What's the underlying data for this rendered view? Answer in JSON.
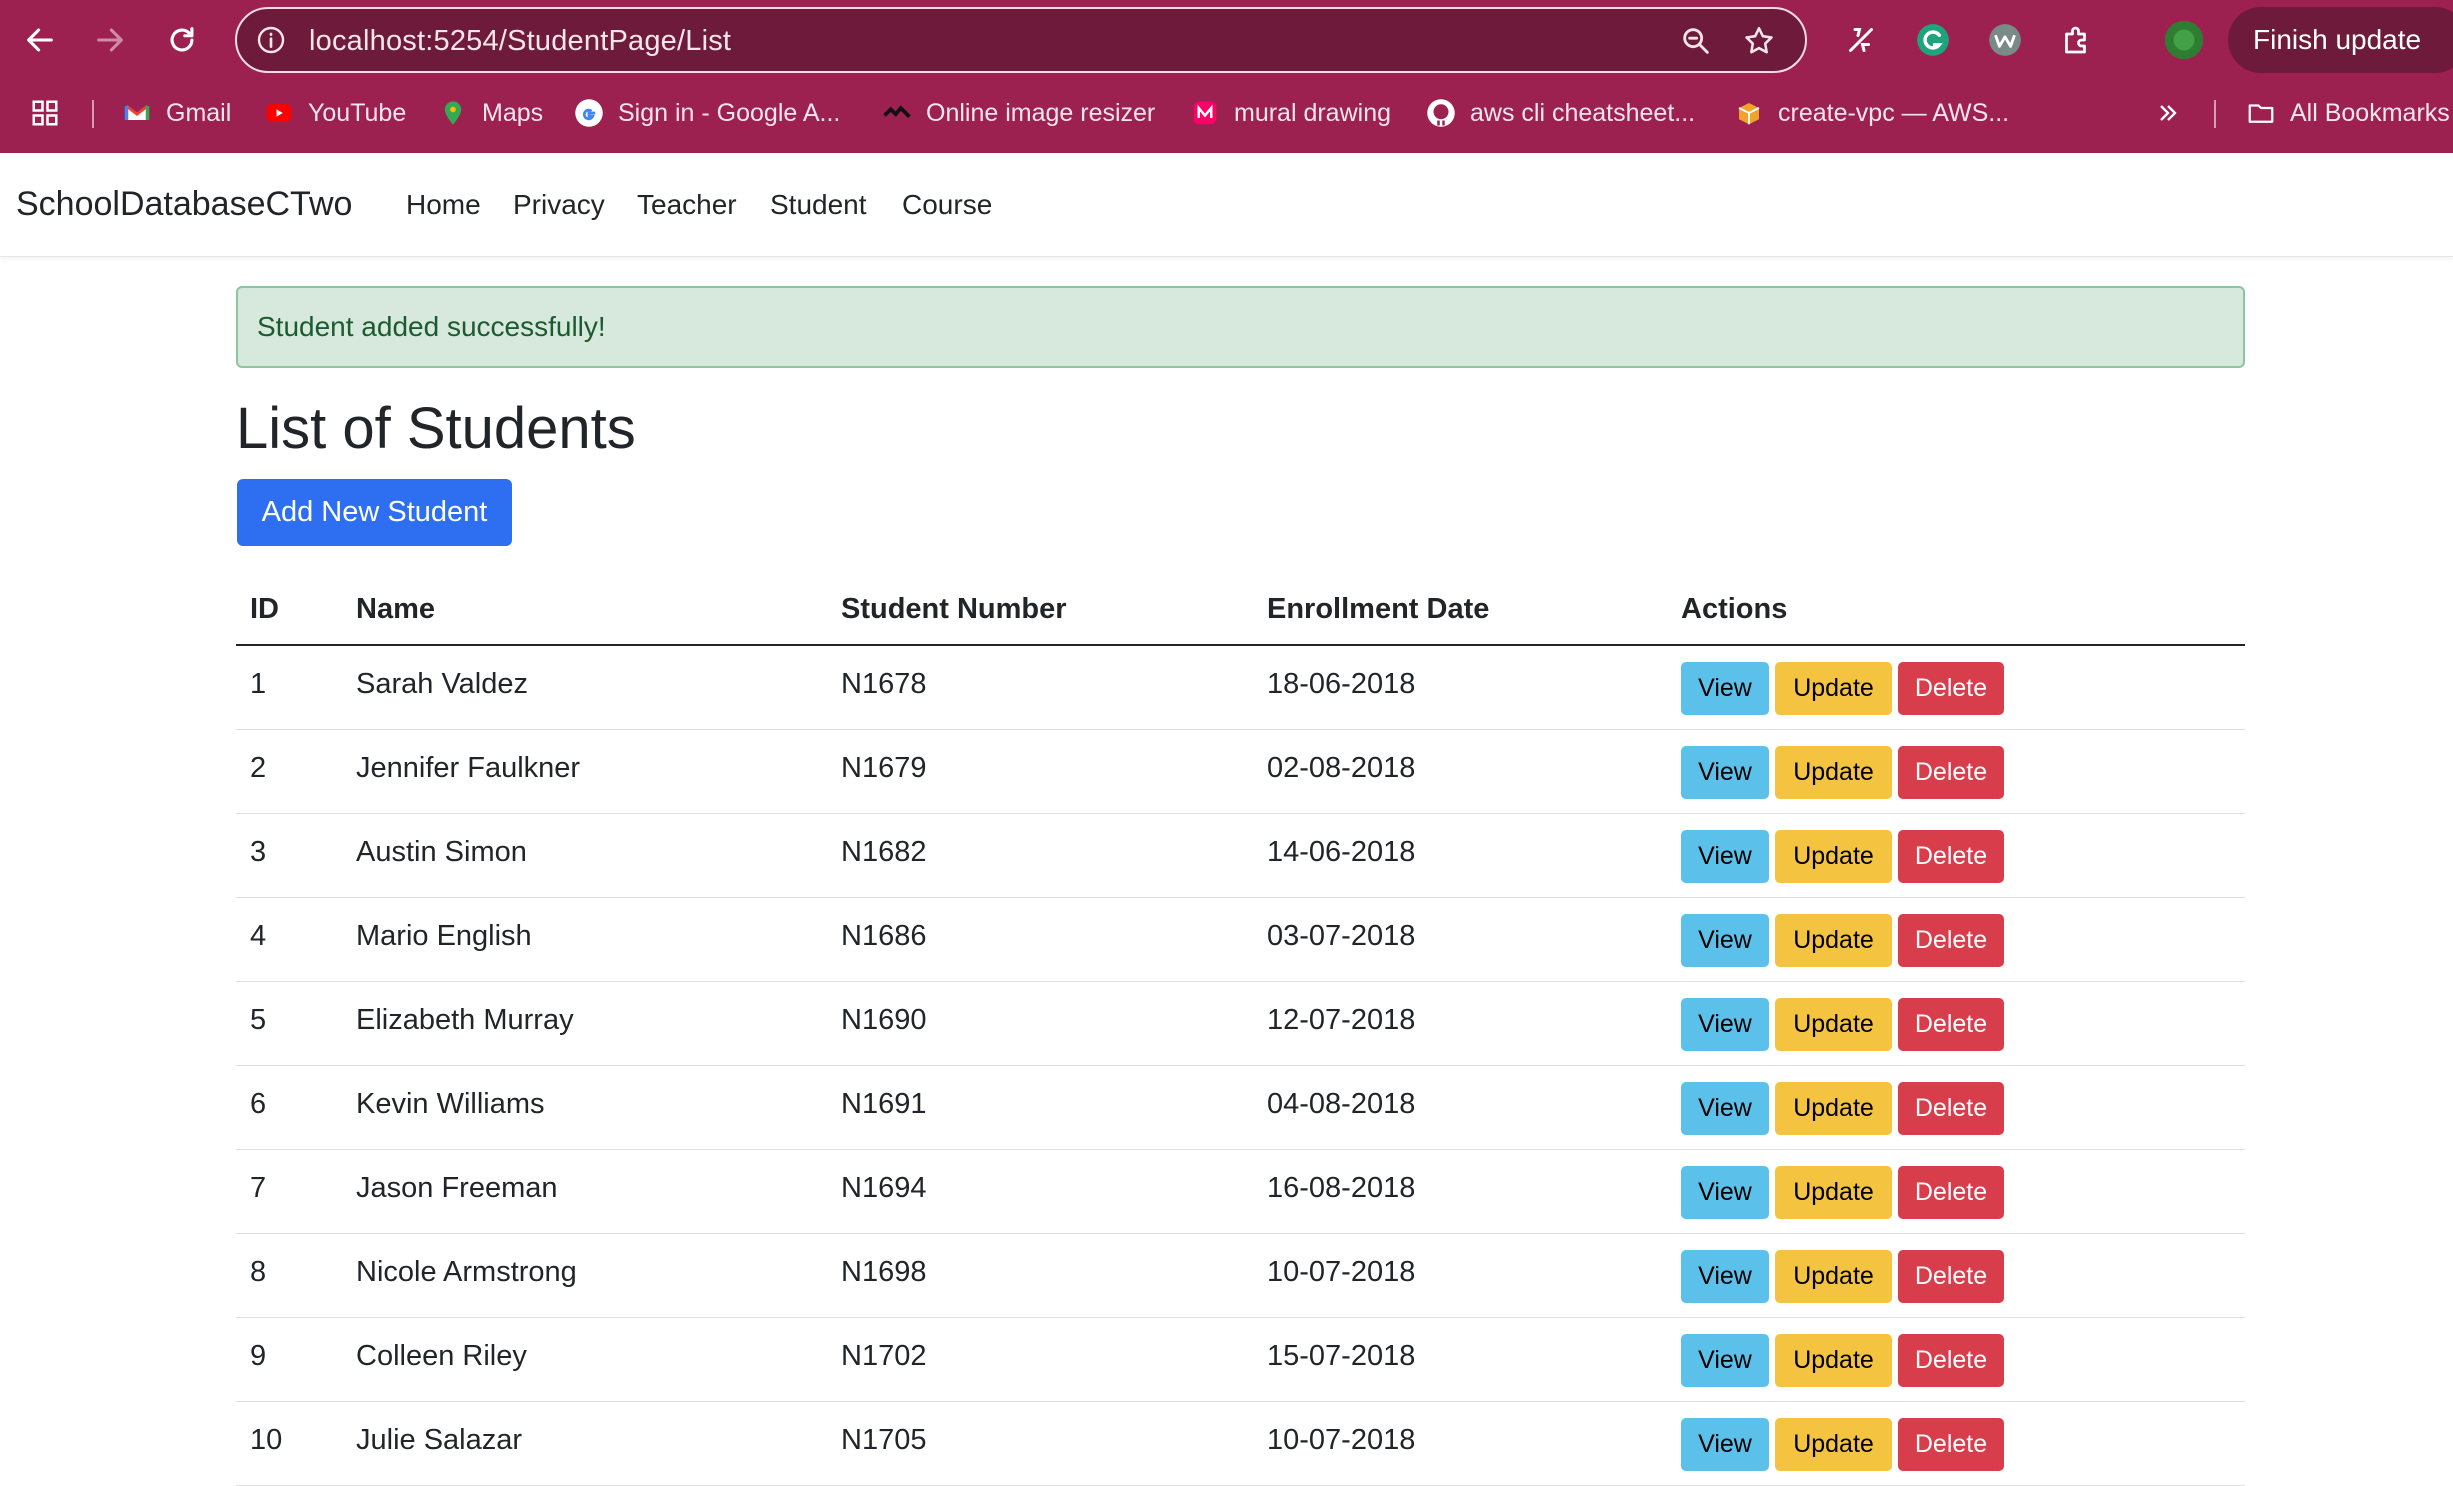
{
  "browser": {
    "url": "localhost:5254/StudentPage/List",
    "finish_update": "Finish update",
    "bookmarks": [
      {
        "label": "Gmail",
        "icon": "gmail-icon"
      },
      {
        "label": "YouTube",
        "icon": "youtube-icon"
      },
      {
        "label": "Maps",
        "icon": "maps-icon"
      },
      {
        "label": "Sign in - Google A...",
        "icon": "google-icon"
      },
      {
        "label": "Online image resizer",
        "icon": "image-resizer-icon"
      },
      {
        "label": "mural drawing",
        "icon": "mural-icon"
      },
      {
        "label": "aws cli cheatsheet...",
        "icon": "github-icon"
      },
      {
        "label": "create-vpc — AWS...",
        "icon": "aws-icon"
      }
    ],
    "all_bookmarks": "All Bookmarks",
    "colors": {
      "chrome": "#9c2150",
      "urlbar": "#6e1a3a"
    }
  },
  "app": {
    "brand": "SchoolDatabaseCTwo",
    "nav": [
      "Home",
      "Privacy",
      "Teacher",
      "Student",
      "Course"
    ]
  },
  "main": {
    "alert": "Student added successfully!",
    "title": "List of Students",
    "add_button": "Add New Student",
    "columns": [
      "ID",
      "Name",
      "Student Number",
      "Enrollment Date",
      "Actions"
    ],
    "actions": {
      "view": "View",
      "update": "Update",
      "delete": "Delete"
    },
    "rows": [
      {
        "id": "1",
        "name": "Sarah Valdez",
        "number": "N1678",
        "date": "18-06-2018"
      },
      {
        "id": "2",
        "name": "Jennifer Faulkner",
        "number": "N1679",
        "date": "02-08-2018"
      },
      {
        "id": "3",
        "name": "Austin Simon",
        "number": "N1682",
        "date": "14-06-2018"
      },
      {
        "id": "4",
        "name": "Mario English",
        "number": "N1686",
        "date": "03-07-2018"
      },
      {
        "id": "5",
        "name": "Elizabeth Murray",
        "number": "N1690",
        "date": "12-07-2018"
      },
      {
        "id": "6",
        "name": "Kevin Williams",
        "number": "N1691",
        "date": "04-08-2018"
      },
      {
        "id": "7",
        "name": "Jason Freeman",
        "number": "N1694",
        "date": "16-08-2018"
      },
      {
        "id": "8",
        "name": "Nicole Armstrong",
        "number": "N1698",
        "date": "10-07-2018"
      },
      {
        "id": "9",
        "name": "Colleen Riley",
        "number": "N1702",
        "date": "15-07-2018"
      },
      {
        "id": "10",
        "name": "Julie Salazar",
        "number": "N1705",
        "date": "10-07-2018"
      }
    ],
    "colors": {
      "primary": "#2d6ff0",
      "info": "#5bc1ea",
      "warning": "#f4c340",
      "danger": "#d73d4b",
      "success_bg": "#d6e9dc"
    }
  }
}
